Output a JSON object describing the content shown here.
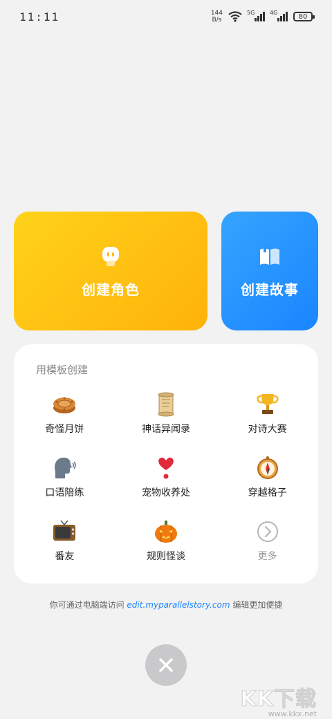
{
  "status_bar": {
    "time": "11:11",
    "net_speed_value": "144",
    "net_speed_unit": "B/s",
    "signal1_label": "5G",
    "signal2_label": "4G",
    "battery": "80"
  },
  "cards": {
    "create_role": "创建角色",
    "create_story": "创建故事"
  },
  "templates": {
    "title": "用模板创建",
    "items": [
      {
        "label": "奇怪月饼",
        "icon": "mooncake-icon"
      },
      {
        "label": "神话异闻录",
        "icon": "scroll-icon"
      },
      {
        "label": "对诗大赛",
        "icon": "trophy-icon"
      },
      {
        "label": "口语陪练",
        "icon": "speaking-head-icon"
      },
      {
        "label": "宠物收养处",
        "icon": "heart-icon"
      },
      {
        "label": "穿越格子",
        "icon": "compass-icon"
      },
      {
        "label": "番友",
        "icon": "tv-icon"
      },
      {
        "label": "规则怪谈",
        "icon": "pumpkin-icon"
      },
      {
        "label": "更多",
        "icon": "chevron-right-icon"
      }
    ]
  },
  "hint": {
    "prefix": "你可通过电脑端访问",
    "link": "edit.myparallelstory.com",
    "suffix": "编辑更加便捷"
  },
  "watermark": {
    "big": "KK下载",
    "small": "www.kkx.net"
  },
  "colors": {
    "role_card": "#ffc10f",
    "story_card": "#2596ff",
    "link": "#1a85ff",
    "background": "#f2f2f2"
  }
}
